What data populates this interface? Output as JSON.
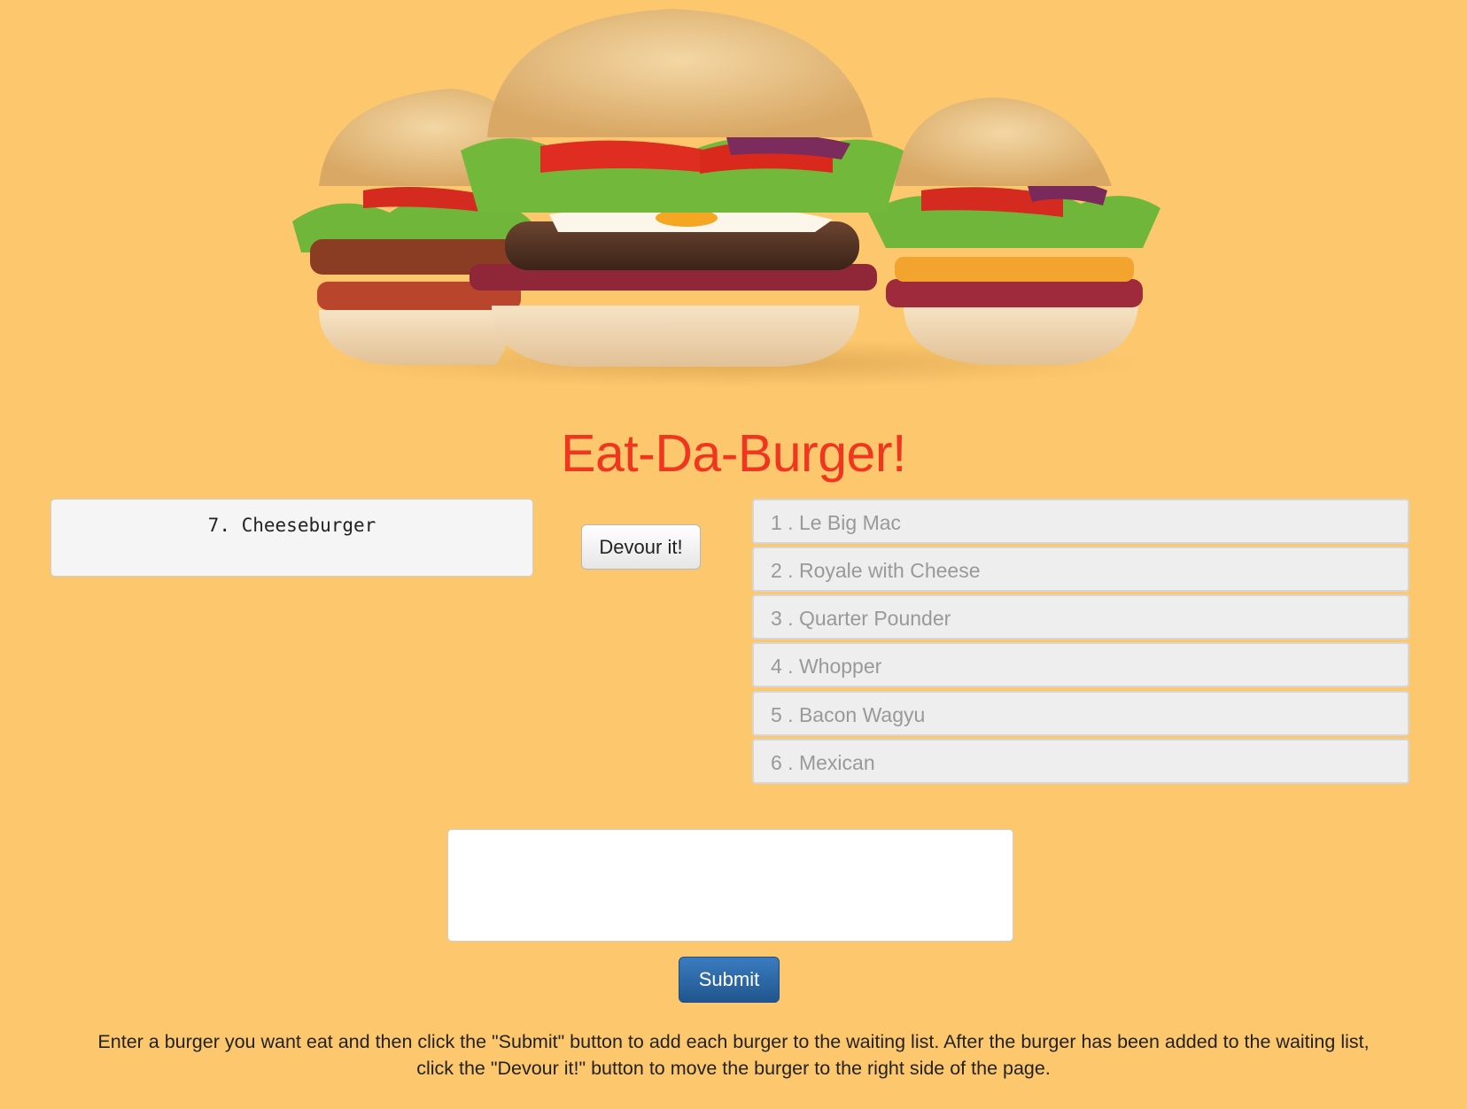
{
  "header": {
    "title": "Eat-Da-Burger!",
    "hero_image": "three-burgers-illustration"
  },
  "waiting": {
    "items": [
      {
        "label": "7. Cheeseburger"
      }
    ],
    "devour_label": "Devour it!"
  },
  "devoured": {
    "items": [
      {
        "label": "1 . Le Big Mac"
      },
      {
        "label": "2 . Royale with Cheese"
      },
      {
        "label": "3 . Quarter Pounder"
      },
      {
        "label": "4 . Whopper"
      },
      {
        "label": "5 . Bacon Wagyu"
      },
      {
        "label": "6 . Mexican"
      }
    ]
  },
  "form": {
    "input_value": "",
    "submit_label": "Submit"
  },
  "instructions": {
    "line1": "Enter a burger you want eat and then click the \"Submit\" button to add each burger to the waiting list. After the burger has been added to the waiting list,",
    "line2": "click the \"Devour it!\" button to move the burger to the right side of the page."
  },
  "colors": {
    "background": "#fdc86d",
    "title": "#f0361f",
    "submit": "#2a64a4"
  }
}
